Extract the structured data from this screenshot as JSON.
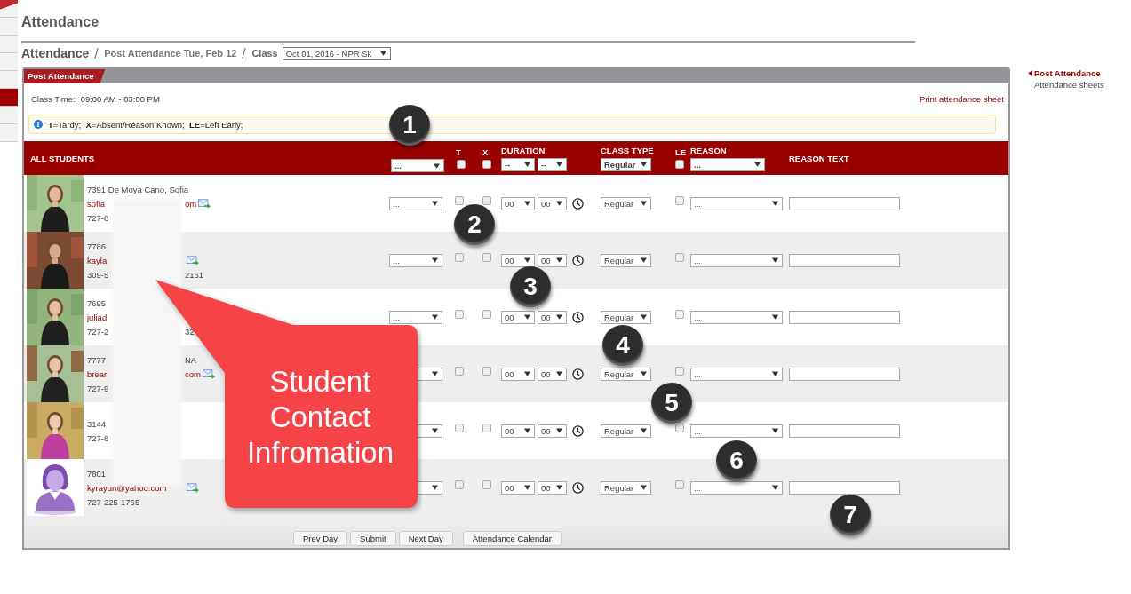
{
  "left_tabs": [
    {
      "selected": false
    },
    {
      "selected": false
    },
    {
      "selected": false
    },
    {
      "selected": false
    },
    {
      "selected": false
    },
    {
      "selected": true
    },
    {
      "selected": false
    },
    {
      "selected": false
    }
  ],
  "page_title": "Attendance",
  "breadcrumb": {
    "root": "Attendance",
    "page": "Post Attendance Tue, Feb 12",
    "class_label": "Class",
    "class_value": "Oct 01, 2016 - NPR Sk"
  },
  "panel": {
    "tab": "Post Attendance",
    "class_time_label": "Class Time:",
    "class_time": "09:00 AM - 03:00 PM",
    "print_link": "Print attendance sheet",
    "legend": "**T**=Tardy;  **X**=Absent/Reason Known;  **LE**=Left Early;"
  },
  "table_header": {
    "all_students": "ALL STUDENTS",
    "status": "...",
    "t_label": "T",
    "t_checked": false,
    "x_label": "X",
    "x_checked": false,
    "duration": "DURATION",
    "hours": "--",
    "minutes": "--",
    "class_type": "CLASS TYPE",
    "class_type_value": "Regular",
    "le_label": "LE",
    "le_checked": false,
    "reason": "REASON",
    "reason_value": "...",
    "reason_text": "REASON TEXT"
  },
  "students": [
    {
      "kind": "picture",
      "lines": [
        {
          "kind": "name",
          "before": "7391 De Moya Cano, Sofia"
        },
        {
          "kind": "email",
          "before": "sofia",
          "after": "om",
          "mail": true
        },
        {
          "kind": "phone",
          "before": "727-8"
        }
      ],
      "status": "...",
      "tardy": false,
      "absent": false,
      "hours": "00",
      "minutes": "00",
      "class_type": "Regular",
      "left_early": false,
      "reason": "..."
    },
    {
      "kind": "picture",
      "lines": [
        {
          "kind": "name",
          "before": "7786"
        },
        {
          "kind": "email",
          "before": "kayla",
          "mail": true
        },
        {
          "kind": "phone",
          "before": "309-5",
          "after": "2161"
        }
      ],
      "status": "...",
      "tardy": false,
      "absent": false,
      "hours": "00",
      "minutes": "00",
      "class_type": "Regular",
      "left_early": false,
      "reason": "..."
    },
    {
      "kind": "picture",
      "lines": [
        {
          "kind": "name",
          "before": "7695"
        },
        {
          "kind": "email",
          "before": "juliad"
        },
        {
          "kind": "phone",
          "before": "727-2",
          "after": "32"
        }
      ],
      "status": "...",
      "tardy": false,
      "absent": false,
      "hours": "00",
      "minutes": "00",
      "class_type": "Regular",
      "left_early": false,
      "reason": "..."
    },
    {
      "kind": "picture",
      "lines": [
        {
          "kind": "name",
          "before": "7777",
          "after": "NA"
        },
        {
          "kind": "email",
          "before": "brear",
          "after": "com",
          "mail": true
        },
        {
          "kind": "phone",
          "before": "727-9"
        }
      ],
      "tardy": false,
      "absent": false,
      "hours": "00",
      "minutes": "00",
      "class_type": "Regular",
      "left_early": false,
      "reason": "..."
    },
    {
      "kind": "picture",
      "lines": [
        {
          "kind": "name",
          "before": "3144"
        },
        {
          "kind": "phone",
          "before": "727-8"
        }
      ],
      "tardy": false,
      "absent": false,
      "hours": "00",
      "minutes": "00",
      "class_type": "Regular",
      "left_early": false,
      "reason": "..."
    },
    {
      "kind": "avatar",
      "lines": [
        {
          "kind": "name",
          "before": "7801"
        },
        {
          "kind": "email",
          "before": "kyrayun@yahoo.com",
          "mail": true
        },
        {
          "kind": "phone",
          "before": "727-225-1765"
        }
      ],
      "tardy": false,
      "absent": false,
      "hours": "00",
      "minutes": "00",
      "class_type": "Regular",
      "left_early": false,
      "reason": "..."
    }
  ],
  "buttons": [
    "Prev Day",
    "Submit",
    "Next Day",
    "Attendance Calendar"
  ],
  "side_nav": [
    {
      "label": "Post Attendance",
      "selected": true
    },
    {
      "label": "Attendance sheets",
      "selected": false
    }
  ],
  "callout": "Student Contact Infromation",
  "markers": [
    "1",
    "2",
    "3",
    "4",
    "5",
    "6",
    "7"
  ]
}
